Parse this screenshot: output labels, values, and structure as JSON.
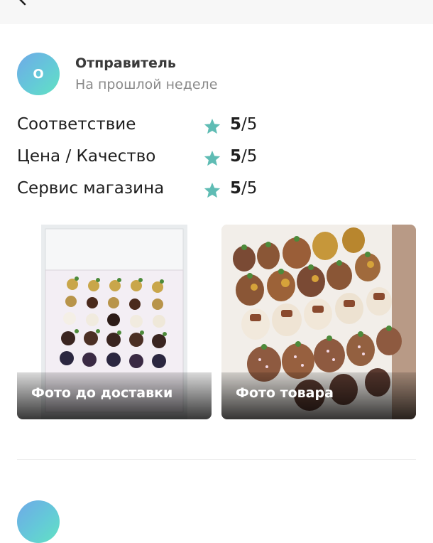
{
  "review": {
    "avatar_letter": "О",
    "author": "Отправитель",
    "date": "На прошлой неделе",
    "ratings": [
      {
        "label": "Соответствие",
        "score": "5",
        "max": "/5"
      },
      {
        "label": "Цена / Качество",
        "score": "5",
        "max": "/5"
      },
      {
        "label": "Сервис магазина",
        "score": "5",
        "max": "/5"
      }
    ],
    "photos": [
      {
        "caption": "Фото до доставки"
      },
      {
        "caption": "Фото товара"
      }
    ]
  },
  "icons": {
    "back": "chevron-left-icon",
    "star": "star-icon"
  },
  "colors": {
    "star": "#5fbcb4",
    "avatar_from": "#6fa9e8",
    "avatar_to": "#62e2c2"
  }
}
